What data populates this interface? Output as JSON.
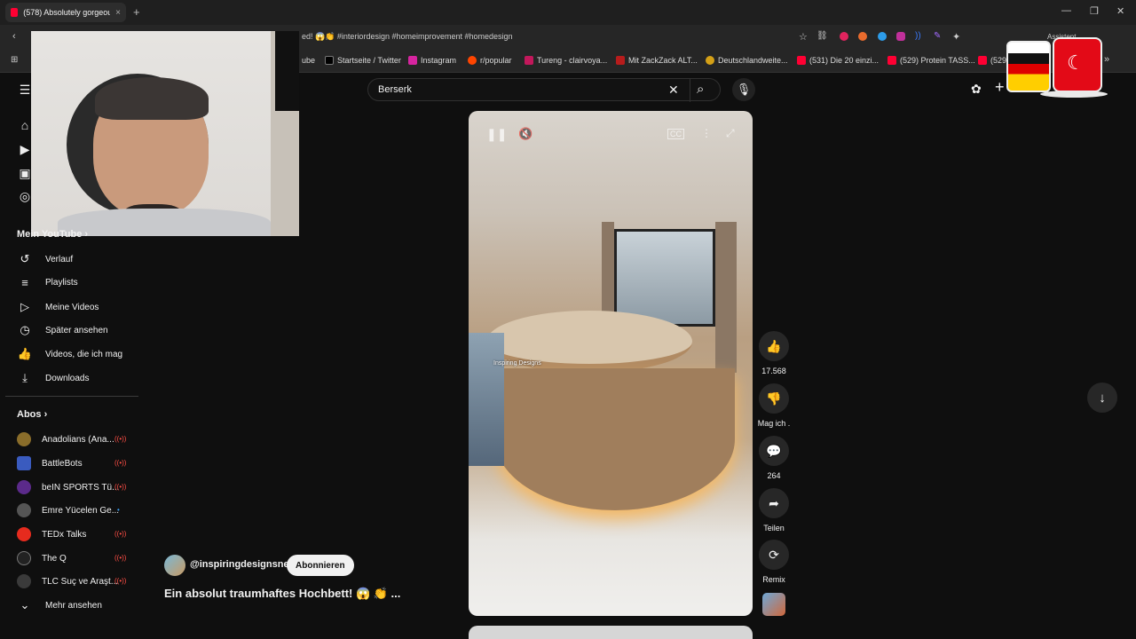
{
  "browser": {
    "tab_title": "(578) Absolutely gorgeous ele",
    "tab_close": "×",
    "new_tab": "+",
    "url_hint": "ed! 😱👏 #interiordesign #homeimprovement #homedesign",
    "assistant_label": "Assistent",
    "bookmarks": [
      {
        "label": "ube"
      },
      {
        "label": "Startseite / Twitter"
      },
      {
        "label": "Instagram"
      },
      {
        "label": "r/popular"
      },
      {
        "label": "Tureng - clairvoya..."
      },
      {
        "label": "Mit ZackZack ALT..."
      },
      {
        "label": "Deutschlandweite..."
      },
      {
        "label": "(531) Die 20 einzi..."
      },
      {
        "label": "(529) Protein TASS..."
      },
      {
        "label": "(529)"
      }
    ]
  },
  "search": {
    "value": "Berserk"
  },
  "sidebar": {
    "my_youtube_heading": "Mein YouTube",
    "items": [
      {
        "label": "Verlauf",
        "icon": "history-icon"
      },
      {
        "label": "Playlists",
        "icon": "playlist-icon"
      },
      {
        "label": "Meine Videos",
        "icon": "my-videos-icon"
      },
      {
        "label": "Später ansehen",
        "icon": "watch-later-icon"
      },
      {
        "label": "Videos, die ich mag",
        "icon": "thumbs-up-icon"
      },
      {
        "label": "Downloads",
        "icon": "download-icon"
      }
    ],
    "subs_heading": "Abos",
    "subscriptions": [
      {
        "label": "Anadolians (Ana...",
        "color": "#8a6d2a"
      },
      {
        "label": "BattleBots",
        "color": "#3a5bbf"
      },
      {
        "label": "beIN SPORTS Tü...",
        "color": "#5b2a8a"
      },
      {
        "label": "Emre Yücelen Ge...",
        "color": "#555555"
      },
      {
        "label": "TEDx Talks",
        "color": "#e62b1e"
      },
      {
        "label": "The Q",
        "color": "#222222"
      },
      {
        "label": "TLC Suç ve Araşt...",
        "color": "#3a3a3a"
      }
    ],
    "more_label": "Mehr ansehen"
  },
  "video": {
    "channel": "@inspiringdesignsnet",
    "subscribe": "Abonnieren",
    "title": "Ein absolut traumhaftes Hochbett! 😱 👏 ...",
    "watermark": "Inspiring Designs"
  },
  "actions": {
    "likes": "17.568",
    "dislike": "Mag ich .",
    "comments": "264",
    "share": "Teilen",
    "remix": "Remix"
  },
  "colors": {
    "background": "#0f0f0f",
    "accent": "#ff0033"
  }
}
